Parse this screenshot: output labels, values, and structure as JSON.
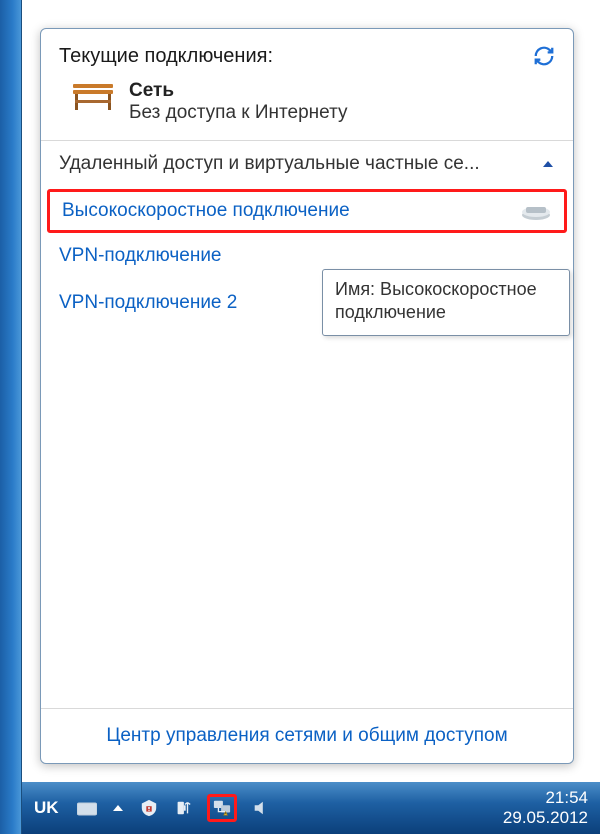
{
  "popup": {
    "title": "Текущие подключения:",
    "network": {
      "name": "Сеть",
      "status": "Без доступа к Интернету"
    },
    "section_header": "Удаленный доступ и виртуальные частные се...",
    "connections": [
      {
        "label": "Высокоскоростное подключение",
        "icon": "modem",
        "highlight": true
      },
      {
        "label": "VPN-подключение",
        "icon": "modem-partial",
        "highlight": false
      },
      {
        "label": "VPN-подключение 2",
        "icon": "server",
        "highlight": false
      }
    ],
    "footer_link": "Центр управления сетями и общим доступом"
  },
  "tooltip": {
    "text": "Имя: Высокоскоростное подключение"
  },
  "taskbar": {
    "language": "UK",
    "time": "21:54",
    "date": "29.05.2012"
  }
}
